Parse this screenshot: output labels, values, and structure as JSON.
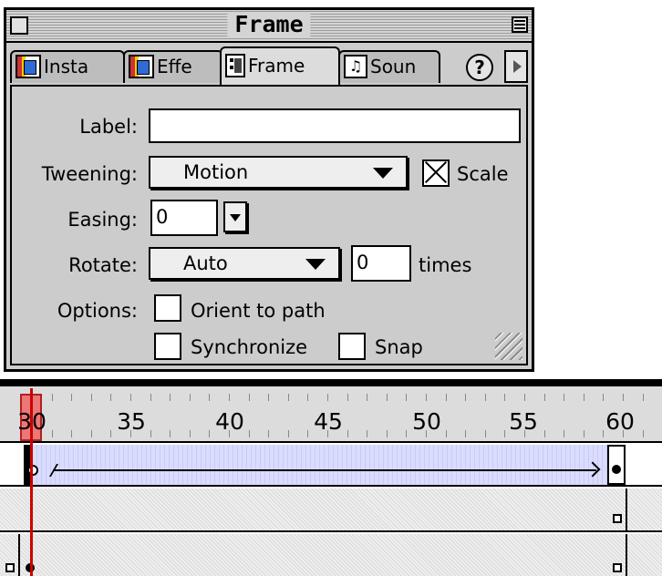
{
  "panel": {
    "title": "Frame",
    "tabs": [
      {
        "label": "Insta",
        "icon": "instance-icon",
        "active": false
      },
      {
        "label": "Effe",
        "icon": "effect-icon",
        "active": false
      },
      {
        "label": "Frame",
        "icon": "frame-icon",
        "active": true
      },
      {
        "label": "Soun",
        "icon": "sound-icon",
        "active": false
      }
    ],
    "help_label": "?",
    "form": {
      "label_label": "Label:",
      "label_value": "",
      "tweening_label": "Tweening:",
      "tweening_value": "Motion",
      "scale_label": "Scale",
      "scale_checked": true,
      "easing_label": "Easing:",
      "easing_value": "0",
      "rotate_label": "Rotate:",
      "rotate_value": "Auto",
      "times_value": "0",
      "times_label": "times",
      "options_label": "Options:",
      "orient_label": "Orient to path",
      "orient_checked": false,
      "synchronize_label": "Synchronize",
      "synchronize_checked": false,
      "snap_label": "Snap",
      "snap_checked": false
    }
  },
  "timeline": {
    "ruler_numbers": [
      "30",
      "35",
      "40",
      "45",
      "50",
      "55",
      "60"
    ],
    "current_frame": "30",
    "tween_color": "#dadcff",
    "playhead_color": "#cc0000"
  }
}
